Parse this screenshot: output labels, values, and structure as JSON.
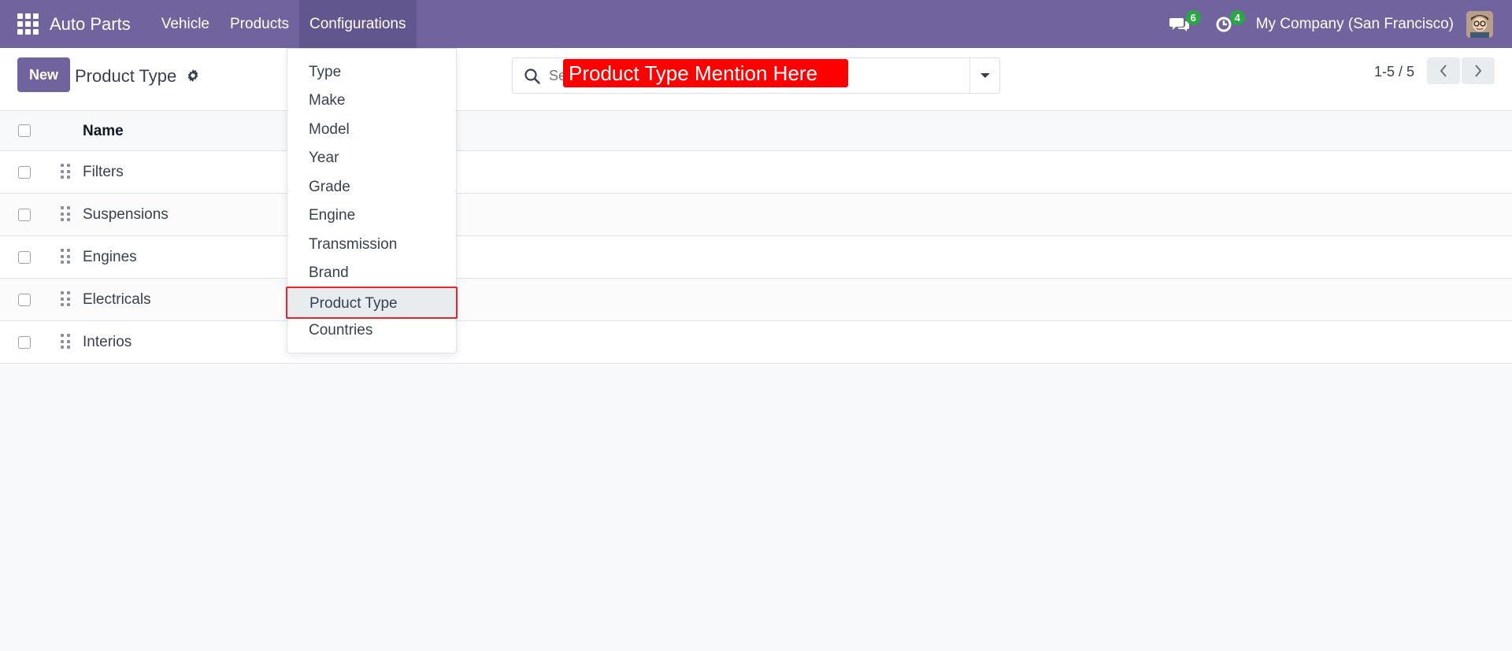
{
  "navbar": {
    "app_name": "Auto Parts",
    "menu": [
      {
        "label": "Vehicle"
      },
      {
        "label": "Products"
      },
      {
        "label": "Configurations"
      }
    ],
    "messages_count": "6",
    "activities_count": "4",
    "company": "My Company (San Francisco)",
    "icons": [
      "apps-grid-icon",
      "chat-icon",
      "clock-icon",
      "avatar"
    ]
  },
  "control_panel": {
    "new_label": "New",
    "title": "Product Type",
    "search_placeholder": "Se",
    "annotation": "Product Type Mention Here",
    "pager": "1-5 / 5"
  },
  "dropdown": {
    "items": [
      {
        "label": "Type"
      },
      {
        "label": "Make"
      },
      {
        "label": "Model"
      },
      {
        "label": "Year"
      },
      {
        "label": "Grade"
      },
      {
        "label": "Engine"
      },
      {
        "label": "Transmission"
      },
      {
        "label": "Brand"
      },
      {
        "label": "Product Type"
      },
      {
        "label": "Countries"
      }
    ],
    "highlighted": "Product Type"
  },
  "list": {
    "column_name": "Name",
    "rows": [
      {
        "name": "Filters"
      },
      {
        "name": "Suspensions"
      },
      {
        "name": "Engines"
      },
      {
        "name": "Electricals"
      },
      {
        "name": "Interios"
      }
    ]
  },
  "colors": {
    "brand": "#71639e",
    "badge": "#28a745",
    "annotation": "#ff0000",
    "highlight_border": "#e8232a"
  }
}
